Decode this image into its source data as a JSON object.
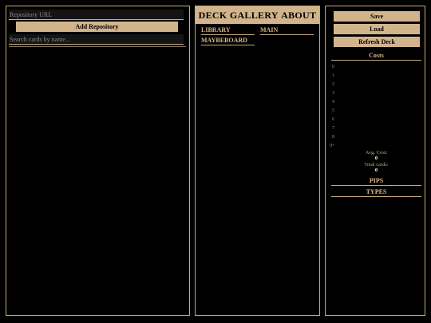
{
  "left": {
    "repo_placeholder": "Repository URL",
    "add_repo_label": "Add Repository",
    "search_placeholder": "Search cards by name..."
  },
  "nav": {
    "deck": "DECK",
    "gallery": "GALLERY",
    "about": "ABOUT"
  },
  "deck_tabs": {
    "library": "LIBRARY",
    "main": "MAIN",
    "maybeboard": "MAYBEBOARD"
  },
  "actions": {
    "save": "Save",
    "load": "Load",
    "refresh": "Refresh Deck"
  },
  "stats": {
    "costs_title": "Costs",
    "cost_buckets": [
      "0",
      "1",
      "2",
      "3",
      "4",
      "5",
      "6",
      "7",
      "8",
      "9+"
    ],
    "avg_cost_label": "Avg. Cost:",
    "avg_cost_value": "0",
    "total_cards_label": "Total cards:",
    "total_cards_value": "0",
    "pips_title": "PIPS",
    "types_title": "TYPES"
  },
  "colors": {
    "accent": "#d2b48c",
    "background": "#000000",
    "border": "#c8a87a"
  }
}
